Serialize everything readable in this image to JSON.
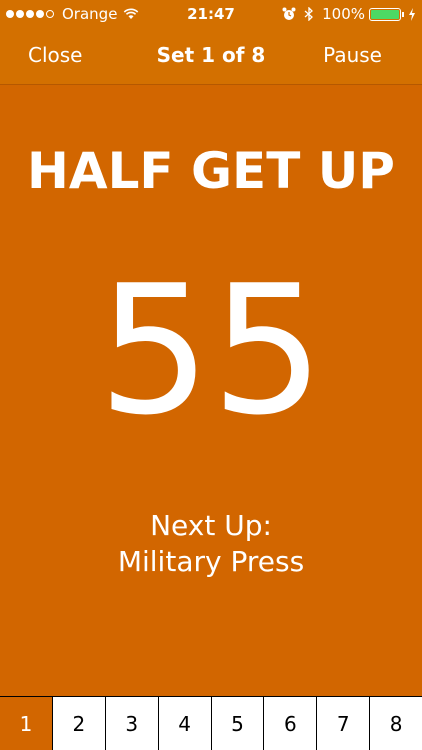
{
  "status_bar": {
    "carrier": "Orange",
    "time": "21:47",
    "battery_percent": "100%",
    "signal_bars": 4,
    "signal_max": 5
  },
  "nav": {
    "close_label": "Close",
    "title": "Set 1 of 8",
    "pause_label": "Pause"
  },
  "main": {
    "exercise": "HALF GET UP",
    "timer": "55",
    "next_up_label": "Next Up:",
    "next_up_exercise": "Military Press"
  },
  "sets": {
    "items": [
      "1",
      "2",
      "3",
      "4",
      "5",
      "6",
      "7",
      "8"
    ],
    "active_index": 0
  },
  "colors": {
    "accent": "#d26600",
    "battery": "#4cd964"
  }
}
